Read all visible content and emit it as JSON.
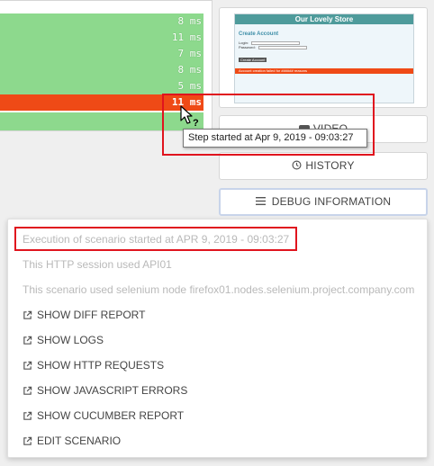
{
  "steps": [
    {
      "duration": "8 ms",
      "status": "passed"
    },
    {
      "duration": "11 ms",
      "status": "passed"
    },
    {
      "duration": "7 ms",
      "status": "passed"
    },
    {
      "duration": "8 ms",
      "status": "passed"
    },
    {
      "duration": "5 ms",
      "status": "passed"
    },
    {
      "duration": "11 ms",
      "status": "failed"
    }
  ],
  "tooltip": {
    "text": "Step started at Apr 9, 2019 - 09:03:27"
  },
  "thumbnail": {
    "store_title": "Our Lovely Store",
    "heading": "Create Account",
    "login_label": "Login:",
    "login_value": "Euro-Git",
    "password_label": "Password:",
    "password_value": "•••••",
    "button_label": "Create Account",
    "error_text": "Account creation failed for ###### reasons"
  },
  "buttons": {
    "video": "VIDEO",
    "history": "HISTORY",
    "debug": "DEBUG INFORMATION"
  },
  "debug_menu": {
    "info": [
      "Execution of scenario started at APR 9, 2019 - 09:03:27",
      "This HTTP session used API01",
      "This scenario used selenium node firefox01.nodes.selenium.project.company.com"
    ],
    "links": [
      "SHOW DIFF REPORT",
      "SHOW LOGS",
      "SHOW HTTP REQUESTS",
      "SHOW JAVASCRIPT ERRORS",
      "SHOW CUCUMBER REPORT",
      "EDIT SCENARIO"
    ]
  },
  "colors": {
    "passed": "#8dd98d",
    "failed": "#ef4a16",
    "highlight": "#e0141e"
  }
}
